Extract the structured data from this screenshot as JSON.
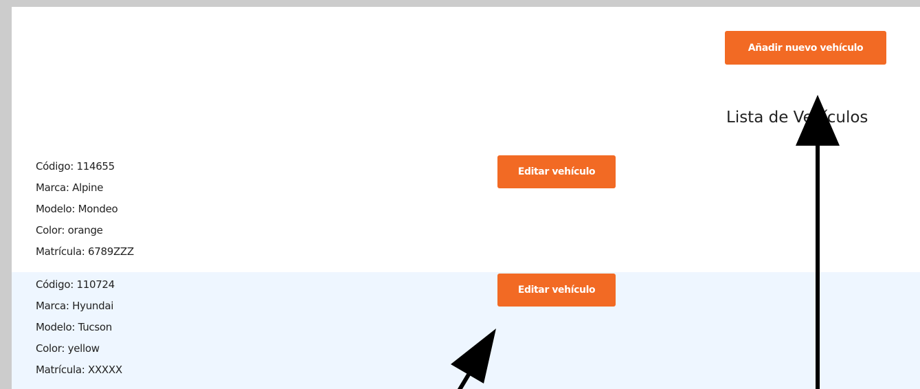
{
  "header": {
    "add_button_label": "Añadir nuevo vehículo"
  },
  "list": {
    "title": "Lista de Vehículos",
    "vehicles": [
      {
        "codigo": "Código: 114655",
        "marca": "Marca: Alpine",
        "modelo": "Modelo: Mondeo",
        "color": "Color: orange",
        "matricula": "Matrícula: 6789ZZZ",
        "edit_label": "Editar vehículo"
      },
      {
        "codigo": "Código: 110724",
        "marca": "Marca: Hyundai",
        "modelo": "Modelo: Tucson",
        "color": "Color: yellow",
        "matricula": "Matrícula: XXXXX",
        "edit_label": "Editar vehículo"
      }
    ]
  },
  "colors": {
    "accent": "#f26a24",
    "row_highlight": "#eef6ff",
    "page_background": "#cccccc"
  },
  "icons": [
    "arrow-up-icon",
    "arrow-diagonal-icon"
  ]
}
